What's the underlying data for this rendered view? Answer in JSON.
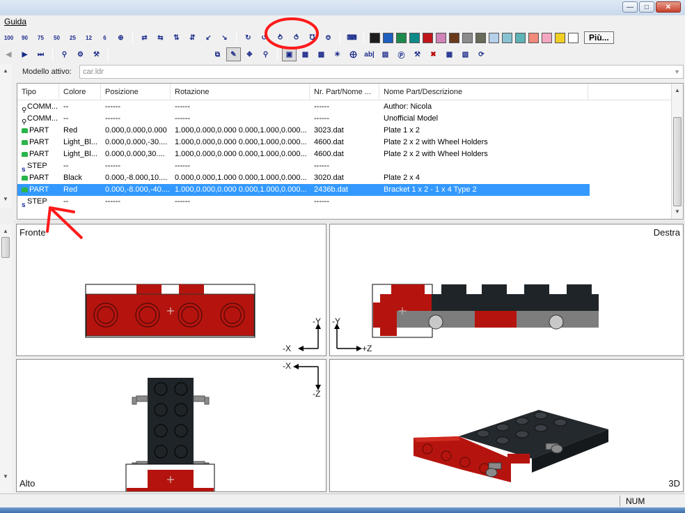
{
  "menu": {
    "help": "Guida"
  },
  "toolbar": {
    "zoom_labels": [
      "100",
      "90",
      "75",
      "50",
      "25",
      "12",
      "6"
    ],
    "more_label": "Più...",
    "colors": [
      "#1e1e1e",
      "#1f5fbf",
      "#1f8a4c",
      "#0f8a8a",
      "#c0161b",
      "#d184b8",
      "#6b3a1a",
      "#8c8c8c",
      "#6a6a5a",
      "#b6d0ea",
      "#88c3d3",
      "#5fb3b5",
      "#f08a7a",
      "#f3a7c0",
      "#f0cf23",
      "#ffffff"
    ]
  },
  "model": {
    "label": "Modello attivo:",
    "value": "car.ldr"
  },
  "table": {
    "headers": [
      "Tipo",
      "Colore",
      "Posizione",
      "Rotazione",
      "Nr. Part/Nome ...",
      "Nome Part/Descrizione"
    ],
    "rows": [
      {
        "type": "COMM...",
        "icon": "comment-icon",
        "color": "--",
        "pos": "------",
        "rot": "------",
        "part": "------",
        "desc": "Author: Nicola"
      },
      {
        "type": "COMM...",
        "icon": "comment-icon",
        "color": "--",
        "pos": "------",
        "rot": "------",
        "part": "------",
        "desc": "Unofficial Model"
      },
      {
        "type": "PART",
        "icon": "part-icon",
        "color": "Red",
        "pos": "0.000,0.000,0.000",
        "rot": "1.000,0.000,0.000 0.000,1.000,0.000...",
        "part": "3023.dat",
        "desc": "Plate  1 x  2"
      },
      {
        "type": "PART",
        "icon": "part-icon",
        "color": "Light_Bl...",
        "pos": "0.000,0.000,-30....",
        "rot": "1.000,0.000,0.000 0.000,1.000,0.000...",
        "part": "4600.dat",
        "desc": "Plate  2 x  2 with Wheel Holders"
      },
      {
        "type": "PART",
        "icon": "part-icon",
        "color": "Light_Bl...",
        "pos": "0.000,0.000,30....",
        "rot": "1.000,0.000,0.000 0.000,1.000,0.000...",
        "part": "4600.dat",
        "desc": "Plate  2 x  2 with Wheel Holders"
      },
      {
        "type": "STEP",
        "icon": "step-icon",
        "color": "--",
        "pos": "------",
        "rot": "------",
        "part": "------",
        "desc": ""
      },
      {
        "type": "PART",
        "icon": "part-icon",
        "color": "Black",
        "pos": "0.000,-8.000,10....",
        "rot": "0.000,0.000,1.000 0.000,1.000,0.000...",
        "part": "3020.dat",
        "desc": "Plate  2 x  4"
      },
      {
        "type": "PART",
        "icon": "part-icon",
        "color": "Red",
        "pos": "0.000,-8.000,-40....",
        "rot": "1.000,0.000,0.000 0.000,1.000,0.000...",
        "part": "2436b.dat",
        "desc": "Bracket  1 x  2 - 1 x  4 Type 2",
        "selected": true
      },
      {
        "type": "STEP",
        "icon": "step-icon",
        "color": "--",
        "pos": "------",
        "rot": "------",
        "part": "------",
        "desc": ""
      }
    ]
  },
  "viewports": {
    "front": {
      "label": "Fronte",
      "axis_v": "-Y",
      "axis_h": "-X"
    },
    "right": {
      "label": "Destra",
      "axis_v": "-Y",
      "axis_h": "+Z"
    },
    "top": {
      "label": "Alto",
      "axis_h": "-X",
      "axis_v": "-Z"
    },
    "persp": {
      "label": "3D"
    }
  },
  "status": {
    "num": "NUM"
  }
}
